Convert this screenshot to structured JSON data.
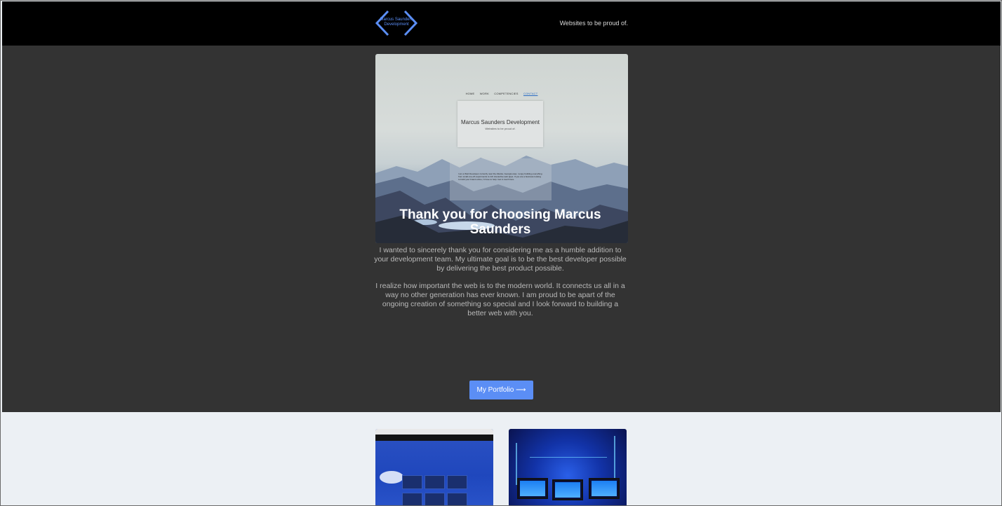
{
  "header": {
    "logo_text": "Marcus Saunders Development",
    "tagline": "Websites to be proud of."
  },
  "hero": {
    "nav": [
      "HOME",
      "WORK",
      "COMPETENCIES",
      "CONTACT"
    ],
    "card_title": "Marcus Saunders Development",
    "card_subtitle": "Websites to be proud of.",
    "box_text": "I am a Web Developer currently near the Atlanta, Georgia area. I enjoy building everything from small one-off experiments to rich interactive web apps. If you are a business looking to build your brand online, I'd love to help. Get in touch here."
  },
  "main": {
    "title": "Thank you for choosing Marcus Saunders",
    "paragraph_1": "I wanted to sincerely thank you for considering me as a humble addition to your development team. My ultimate goal is to be the best developer possible by delivering the best product possible.",
    "paragraph_2": "I realize how important the web is to the modern world. It connects us all in a way no other generation has ever known. I am proud to be apart of the ongoing creation of something so special and I look forward to building a better web with you.",
    "button_label": "My Portfolio ⟶"
  },
  "colors": {
    "accent": "#5b8ef5",
    "header_bg": "#000000",
    "section_bg": "#333333",
    "footer_bg": "#ecf0f4"
  }
}
